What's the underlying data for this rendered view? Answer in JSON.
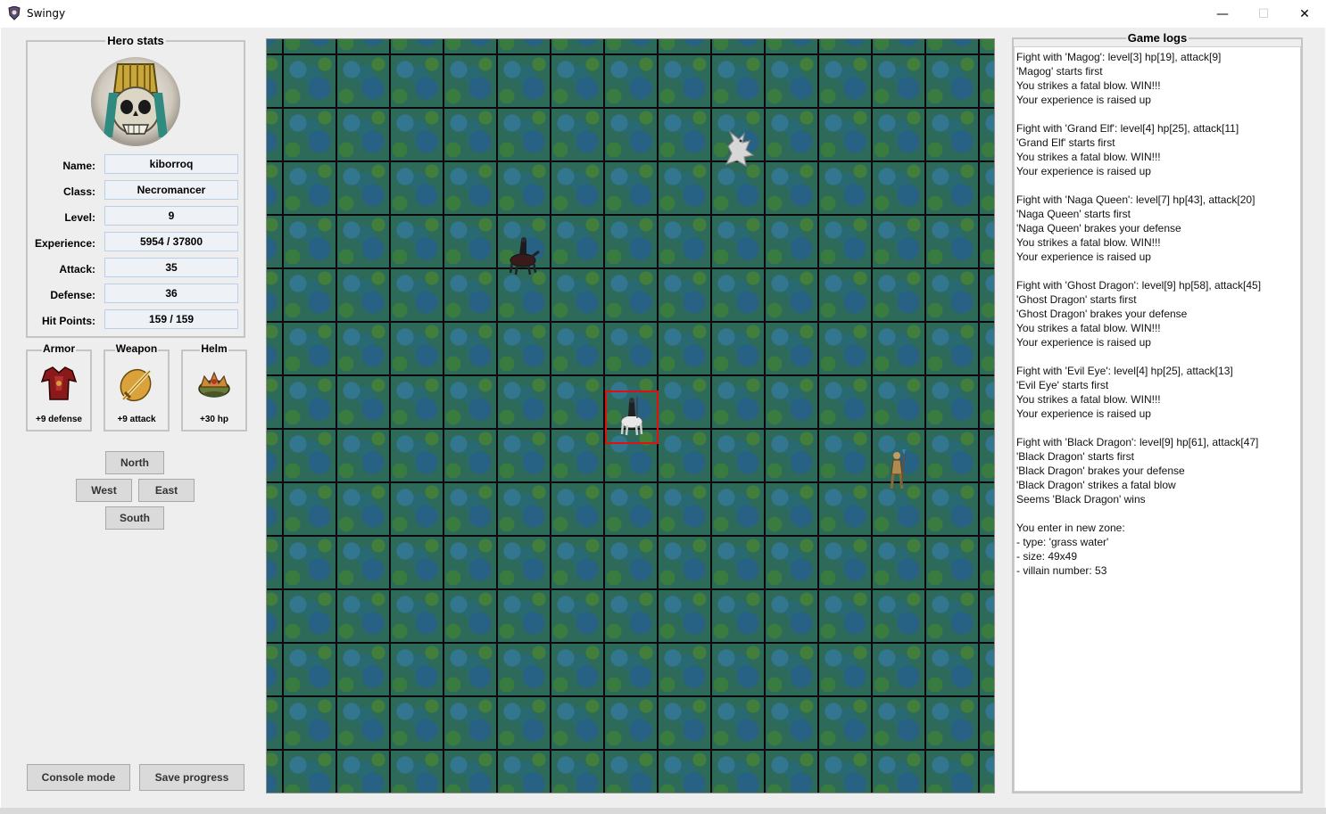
{
  "window": {
    "title": "Swingy",
    "controls": {
      "minimize": "—",
      "maximize": "☐",
      "close": "✕"
    }
  },
  "hero_stats": {
    "title": "Hero stats",
    "avatar_icon": "skull-pharaoh-portrait",
    "fields": [
      {
        "label": "Name:",
        "value": "kiborroq"
      },
      {
        "label": "Class:",
        "value": "Necromancer"
      },
      {
        "label": "Level:",
        "value": "9"
      },
      {
        "label": "Experience:",
        "value": "5954 / 37800"
      },
      {
        "label": "Attack:",
        "value": "35"
      },
      {
        "label": "Defense:",
        "value": "36"
      },
      {
        "label": "Hit Points:",
        "value": "159 / 159"
      }
    ]
  },
  "equipment": [
    {
      "title": "Armor",
      "icon": "red-armor-icon",
      "bonus": "+9 defense"
    },
    {
      "title": "Weapon",
      "icon": "golden-sword-icon",
      "bonus": "+9 attack"
    },
    {
      "title": "Helm",
      "icon": "crown-helm-icon",
      "bonus": "+30 hp"
    }
  ],
  "navigation": {
    "north": "North",
    "west": "West",
    "east": "East",
    "south": "South"
  },
  "actions": {
    "console_mode": "Console mode",
    "save_progress": "Save progress"
  },
  "map": {
    "tile": "grass water",
    "sprites": [
      "white-dragon-sprite",
      "dark-horseman-sprite",
      "hero-knight-sprite",
      "spear-warrior-sprite"
    ]
  },
  "game_logs": {
    "title": "Game logs",
    "lines": [
      "Fight with 'Magog': level[3] hp[19], attack[9]",
      "'Magog' starts first",
      "You strikes a fatal blow. WIN!!!",
      "Your experience is raised up",
      "",
      "Fight with 'Grand Elf': level[4] hp[25], attack[11]",
      "'Grand Elf' starts first",
      "You strikes a fatal blow. WIN!!!",
      "Your experience is raised up",
      "",
      "Fight with 'Naga Queen': level[7] hp[43], attack[20]",
      "'Naga Queen' starts first",
      "'Naga Queen' brakes your defense",
      "You strikes a fatal blow. WIN!!!",
      "Your experience is raised up",
      "",
      "Fight with 'Ghost Dragon': level[9] hp[58], attack[45]",
      "'Ghost Dragon' starts first",
      "'Ghost Dragon' brakes your defense",
      "You strikes a fatal blow. WIN!!!",
      "Your experience is raised up",
      "",
      "Fight with 'Evil Eye': level[4] hp[25], attack[13]",
      "'Evil Eye' starts first",
      "You strikes a fatal blow. WIN!!!",
      "Your experience is raised up",
      "",
      "Fight with 'Black Dragon': level[9] hp[61], attack[47]",
      "'Black Dragon' starts first",
      "'Black Dragon' brakes your defense",
      "'Black Dragon' strikes a fatal blow",
      "Seems 'Black Dragon' wins",
      "",
      "You enter in new zone:",
      "- type: 'grass water'",
      "- size: 49x49",
      "- villain number: 53"
    ]
  }
}
